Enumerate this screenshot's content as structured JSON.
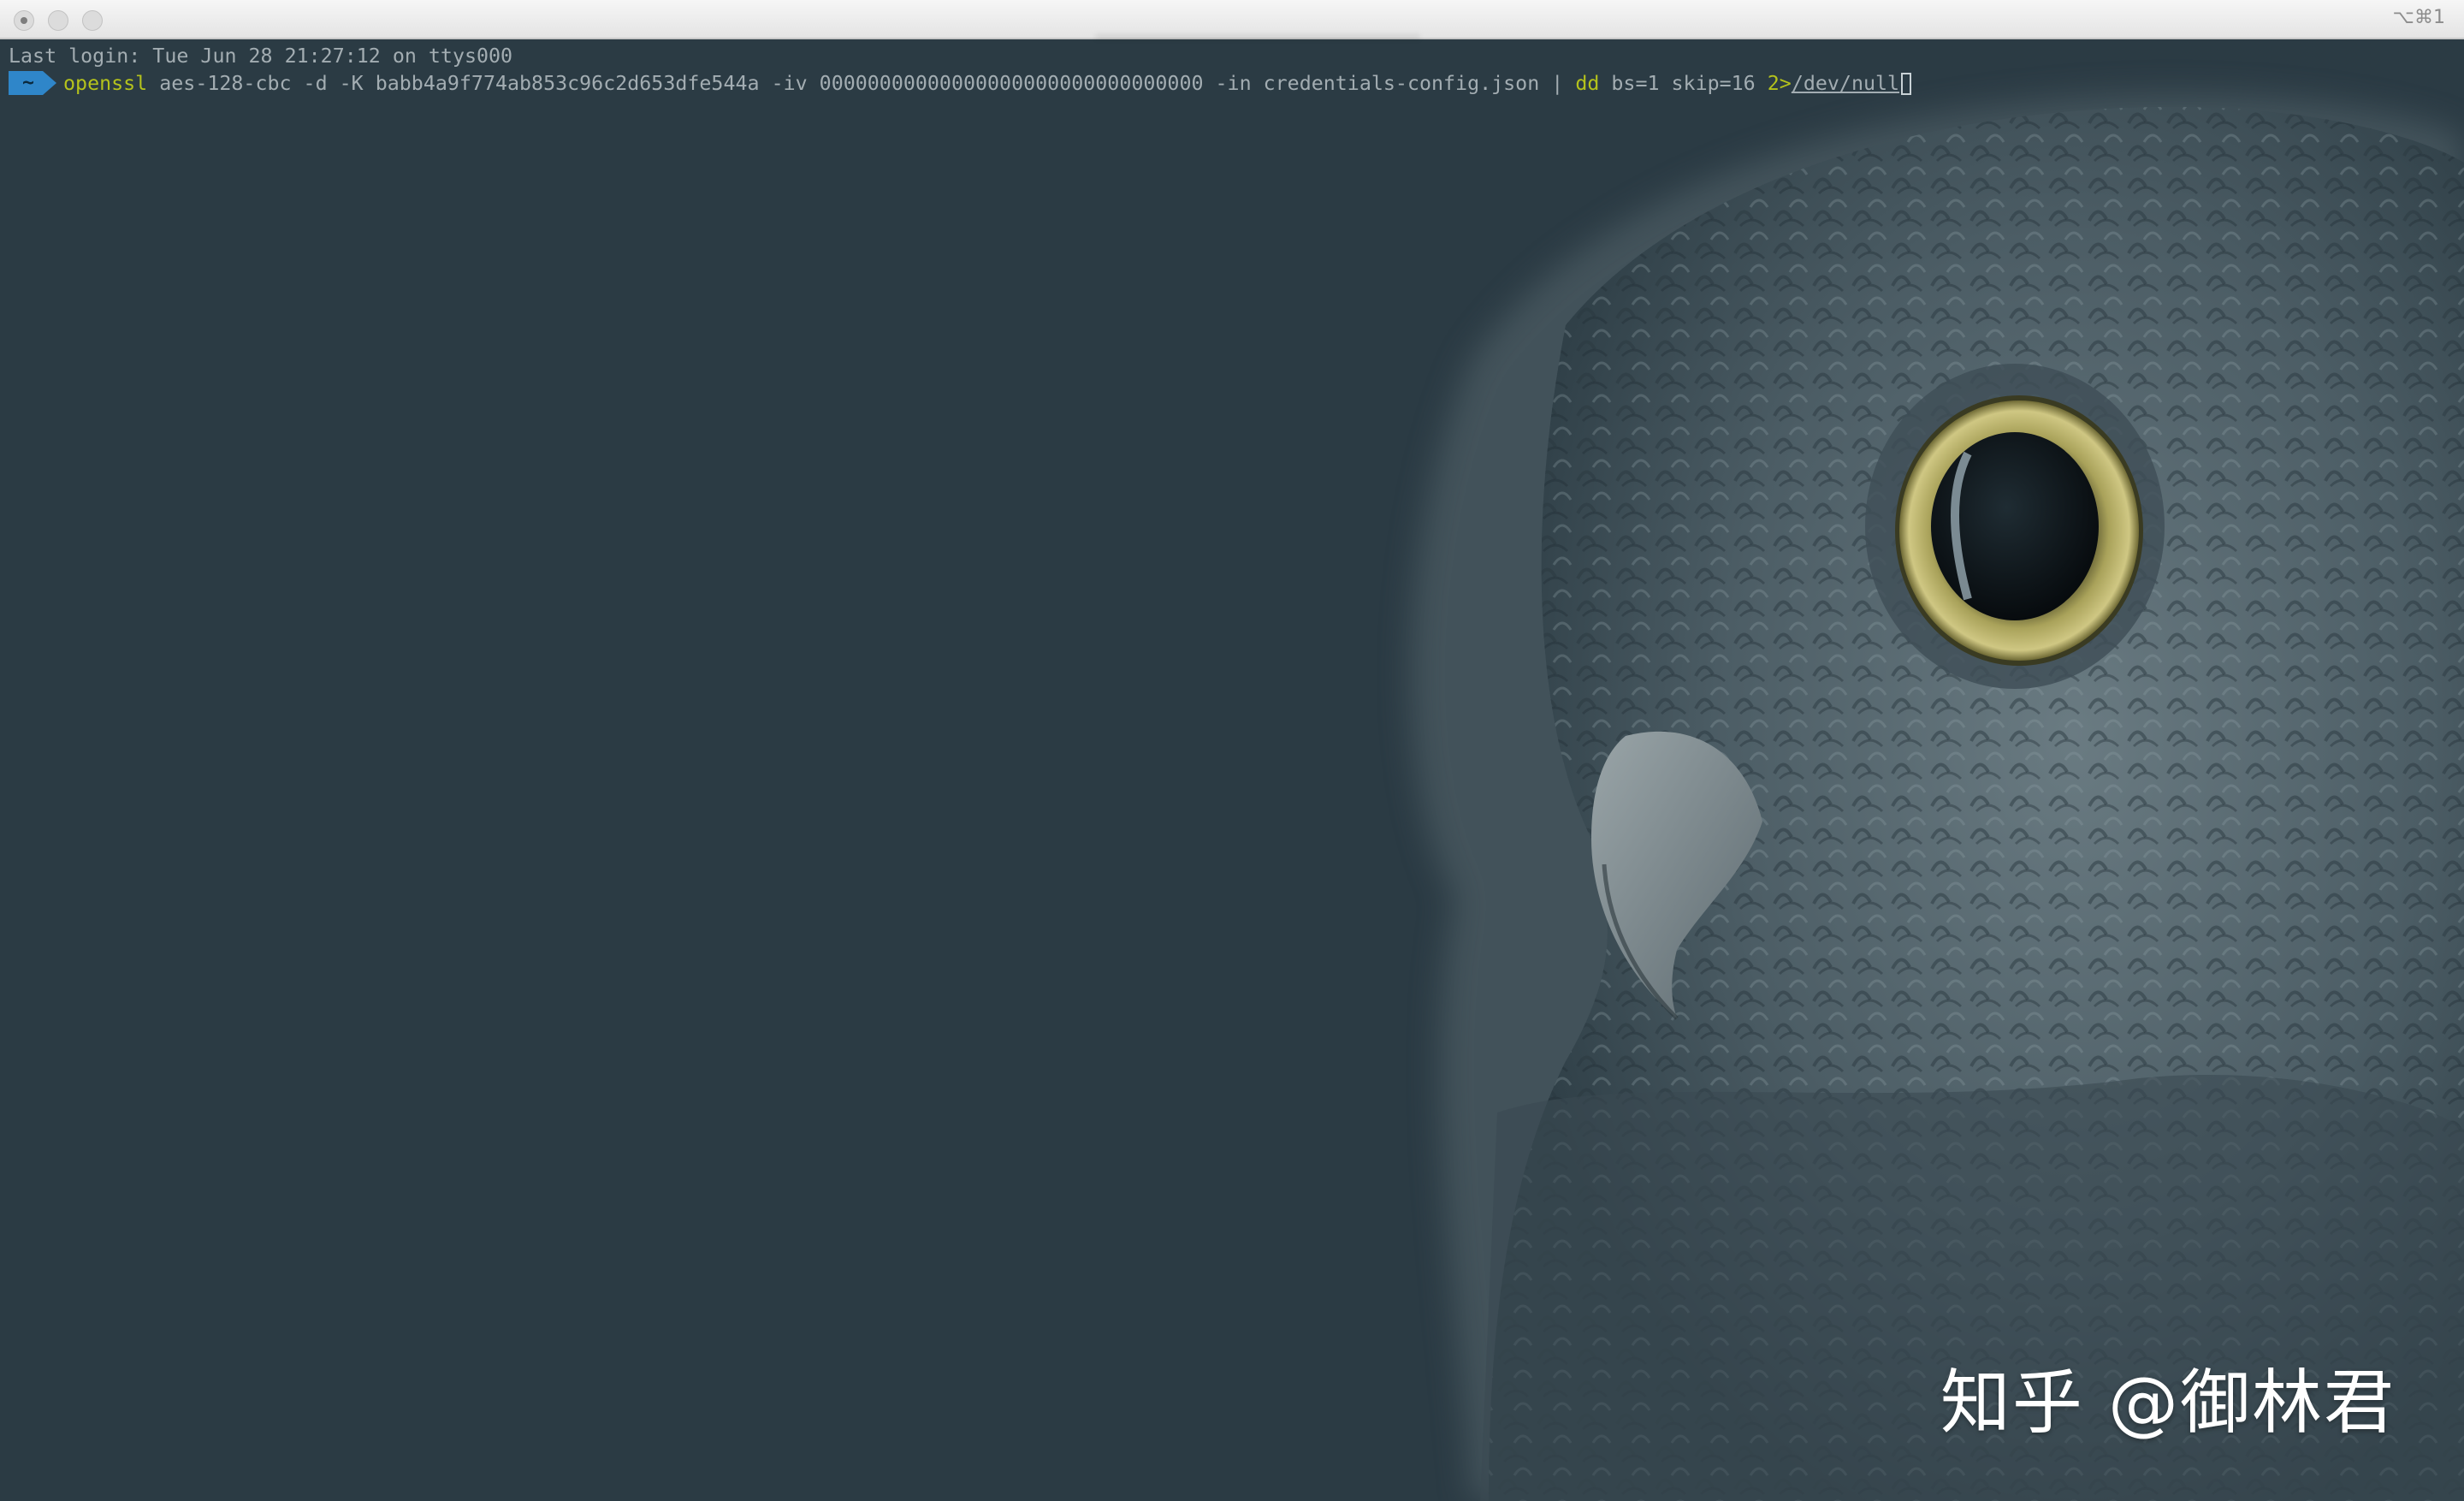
{
  "window": {
    "title": "",
    "shortcut": "⌥⌘1"
  },
  "terminal": {
    "last_login": "Last login: Tue Jun 28 21:27:12 on ttys000",
    "prompt_dir": "~",
    "command": {
      "cmd1": "openssl",
      "args1": " aes-128-cbc -d -K babb4a9f774ab853c96c2d653dfe544a -iv 00000000000000000000000000000000 -in credentials-config.json | ",
      "cmd2": "dd",
      "args2": " bs=1 skip=16 ",
      "redirect": "2>",
      "path": "/dev/null"
    }
  },
  "watermark": "知乎 @御林君",
  "colors": {
    "background": "#2b3b44",
    "prompt_segment": "#2f86c9",
    "command": "#b4c21c",
    "text": "#a3adb2"
  },
  "icons": [
    "window-close-icon",
    "window-minimize-icon",
    "window-zoom-icon"
  ]
}
